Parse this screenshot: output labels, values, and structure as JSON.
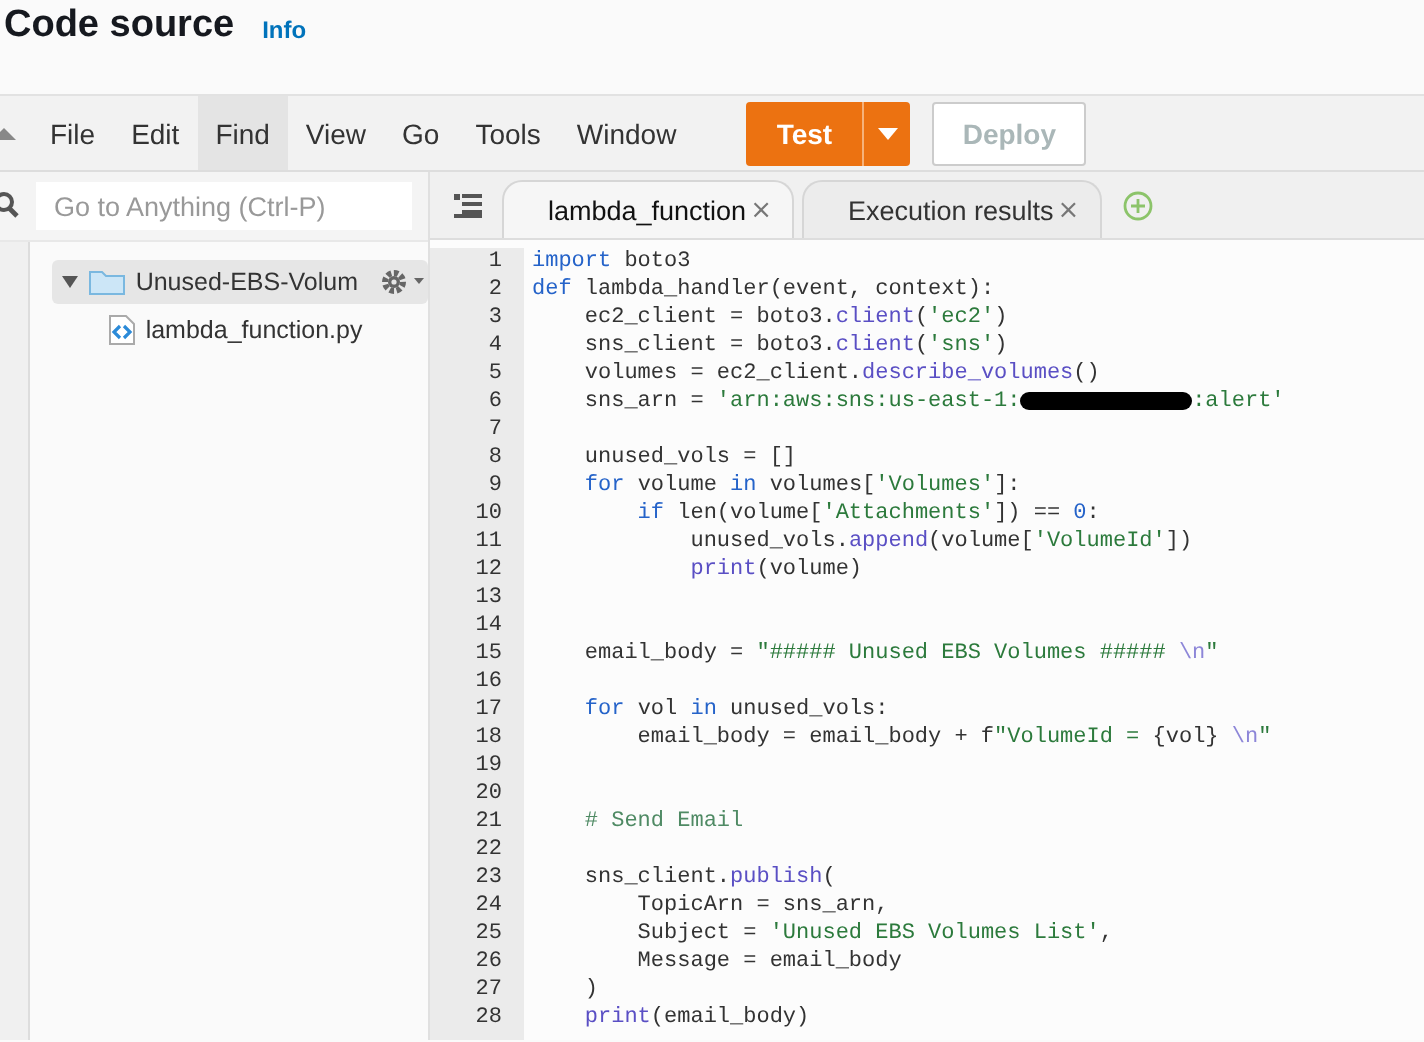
{
  "header": {
    "title": "Code source",
    "info_link": "Info"
  },
  "menu": [
    {
      "label": "File",
      "selected": false
    },
    {
      "label": "Edit",
      "selected": false
    },
    {
      "label": "Find",
      "selected": true
    },
    {
      "label": "View",
      "selected": false
    },
    {
      "label": "Go",
      "selected": false
    },
    {
      "label": "Tools",
      "selected": false
    },
    {
      "label": "Window",
      "selected": false
    }
  ],
  "test_button": {
    "label": "Test"
  },
  "deploy_button": {
    "label": "Deploy",
    "disabled": true
  },
  "search": {
    "placeholder": "Go to Anything (Ctrl-P)"
  },
  "file_tree": [
    {
      "kind": "folder",
      "label": "Unused-EBS-Volum",
      "expanded": true,
      "selected": true,
      "children": [
        {
          "kind": "file",
          "label": "lambda_function.py",
          "selected": false
        }
      ]
    }
  ],
  "editor_tabs": [
    {
      "label": "lambda_function",
      "close": "×",
      "selected": true
    },
    {
      "label": "Execution results",
      "close": "×",
      "selected": false
    }
  ],
  "code_lines": [
    {
      "number": "1",
      "tokens": [
        {
          "kind": "kw",
          "text": "import"
        },
        {
          "kind": "plain",
          "text": " boto3"
        }
      ]
    },
    {
      "number": "2",
      "tokens": [
        {
          "kind": "kw",
          "text": "def"
        },
        {
          "kind": "plain",
          "text": " lambda_handler(event, context):"
        }
      ]
    },
    {
      "number": "3",
      "tokens": [
        {
          "kind": "plain",
          "text": "    ec2_client = boto3."
        },
        {
          "kind": "fn",
          "text": "client"
        },
        {
          "kind": "plain",
          "text": "("
        },
        {
          "kind": "str",
          "text": "'ec2'"
        },
        {
          "kind": "plain",
          "text": ")"
        }
      ]
    },
    {
      "number": "4",
      "tokens": [
        {
          "kind": "plain",
          "text": "    sns_client = boto3."
        },
        {
          "kind": "fn",
          "text": "client"
        },
        {
          "kind": "plain",
          "text": "("
        },
        {
          "kind": "str",
          "text": "'sns'"
        },
        {
          "kind": "plain",
          "text": ")"
        }
      ]
    },
    {
      "number": "5",
      "tokens": [
        {
          "kind": "plain",
          "text": "    volumes = ec2_client."
        },
        {
          "kind": "fn",
          "text": "describe_volumes"
        },
        {
          "kind": "plain",
          "text": "()"
        }
      ]
    },
    {
      "number": "6",
      "tokens": [
        {
          "kind": "plain",
          "text": "    sns_arn = "
        },
        {
          "kind": "str",
          "text": "'arn:aws:sns:us-east-1:"
        },
        {
          "kind": "redaction"
        },
        {
          "kind": "str",
          "text": ":alert'"
        }
      ]
    },
    {
      "number": "7"
    },
    {
      "number": "8",
      "tokens": [
        {
          "kind": "plain",
          "text": "    unused_vols = []"
        }
      ]
    },
    {
      "number": "9",
      "tokens": [
        {
          "kind": "kw",
          "text": "    for"
        },
        {
          "kind": "plain",
          "text": " volume "
        },
        {
          "kind": "kw",
          "text": "in"
        },
        {
          "kind": "plain",
          "text": " volumes["
        },
        {
          "kind": "str",
          "text": "'Volumes'"
        },
        {
          "kind": "plain",
          "text": "]:"
        }
      ]
    },
    {
      "number": "10",
      "tokens": [
        {
          "kind": "kw",
          "text": "        if"
        },
        {
          "kind": "plain",
          "text": " len(volume["
        },
        {
          "kind": "str",
          "text": "'Attachments'"
        },
        {
          "kind": "plain",
          "text": "]) == "
        },
        {
          "kind": "num",
          "text": "0"
        },
        {
          "kind": "plain",
          "text": ":"
        }
      ]
    },
    {
      "number": "11",
      "tokens": [
        {
          "kind": "plain",
          "text": "            unused_vols."
        },
        {
          "kind": "fn",
          "text": "append"
        },
        {
          "kind": "plain",
          "text": "(volume["
        },
        {
          "kind": "str",
          "text": "'VolumeId'"
        },
        {
          "kind": "plain",
          "text": "])"
        }
      ]
    },
    {
      "number": "12",
      "tokens": [
        {
          "kind": "fn",
          "text": "            print"
        },
        {
          "kind": "plain",
          "text": "(volume)"
        }
      ]
    },
    {
      "number": "13"
    },
    {
      "number": "14"
    },
    {
      "number": "15",
      "tokens": [
        {
          "kind": "plain",
          "text": "    email_body = "
        },
        {
          "kind": "str",
          "text": "\"##### Unused EBS Volumes ##### "
        },
        {
          "kind": "esc",
          "text": "\\n"
        },
        {
          "kind": "str",
          "text": "\""
        }
      ]
    },
    {
      "number": "16"
    },
    {
      "number": "17",
      "tokens": [
        {
          "kind": "kw",
          "text": "    for"
        },
        {
          "kind": "plain",
          "text": " vol "
        },
        {
          "kind": "kw",
          "text": "in"
        },
        {
          "kind": "plain",
          "text": " unused_vols:"
        }
      ]
    },
    {
      "number": "18",
      "tokens": [
        {
          "kind": "plain",
          "text": "        email_body = email_body + f"
        },
        {
          "kind": "str",
          "text": "\"VolumeId = "
        },
        {
          "kind": "plain",
          "text": "{vol} "
        },
        {
          "kind": "esc",
          "text": "\\n"
        },
        {
          "kind": "str",
          "text": "\""
        }
      ]
    },
    {
      "number": "19"
    },
    {
      "number": "20"
    },
    {
      "number": "21",
      "tokens": [
        {
          "kind": "comment",
          "text": "    # Send Email"
        }
      ]
    },
    {
      "number": "22"
    },
    {
      "number": "23",
      "tokens": [
        {
          "kind": "plain",
          "text": "    sns_client."
        },
        {
          "kind": "fn",
          "text": "publish"
        },
        {
          "kind": "plain",
          "text": "("
        }
      ]
    },
    {
      "number": "24",
      "tokens": [
        {
          "kind": "plain",
          "text": "        TopicArn = sns_arn,"
        }
      ]
    },
    {
      "number": "25",
      "tokens": [
        {
          "kind": "plain",
          "text": "        Subject = "
        },
        {
          "kind": "str",
          "text": "'Unused EBS Volumes List'"
        },
        {
          "kind": "plain",
          "text": ","
        }
      ]
    },
    {
      "number": "26",
      "tokens": [
        {
          "kind": "plain",
          "text": "        Message = email_body"
        }
      ]
    },
    {
      "number": "27",
      "tokens": [
        {
          "kind": "plain",
          "text": "    )"
        }
      ]
    },
    {
      "number": "28",
      "tokens": [
        {
          "kind": "fn",
          "text": "    print"
        },
        {
          "kind": "plain",
          "text": "(email_body)"
        }
      ]
    }
  ]
}
